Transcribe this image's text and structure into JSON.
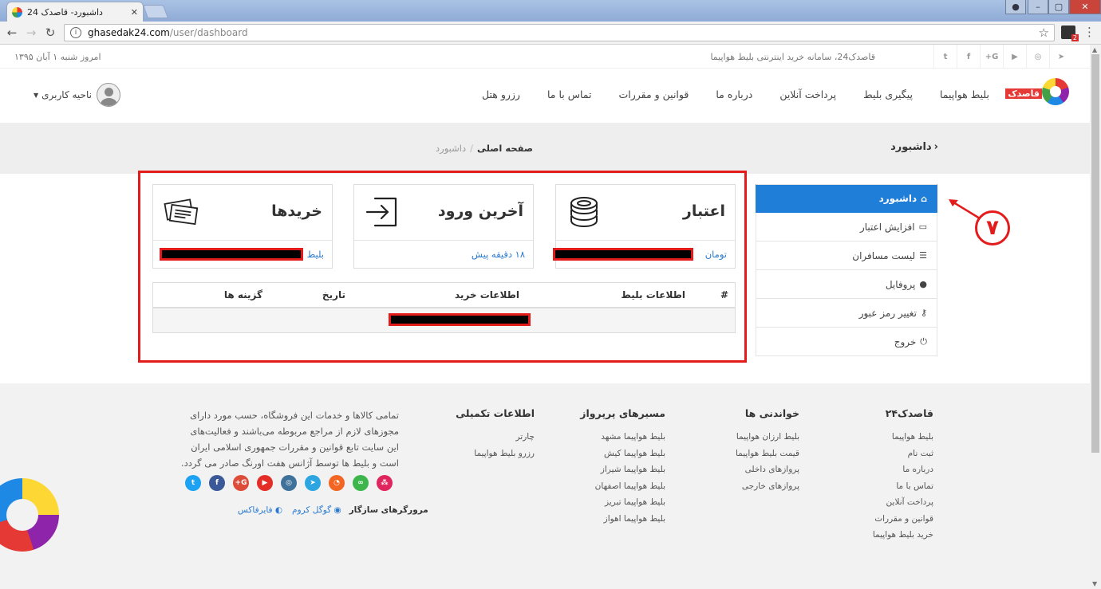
{
  "browser": {
    "tab_title": "داشبورد- قاصدک 24",
    "url_host": "ghasedak24.com",
    "url_path": "/user/dashboard",
    "ext_badge": "2"
  },
  "topbar": {
    "date": "امروز شنبه ۱ آبان ۱۳۹۵",
    "slogan": "قاصدک24، سامانه خرید اینترنتی بلیط هواپیما"
  },
  "nav": {
    "logo_text": "قاصدک",
    "links": [
      "بلیط هواپیما",
      "پیگیری بلیط",
      "پرداخت آنلاین",
      "درباره ما",
      "قوانین و مقررات",
      "تماس با ما",
      "رزرو هتل"
    ],
    "user_label": "ناحیه کاربری"
  },
  "titlebar": {
    "title": "داشبورد",
    "crumb_home": "صفحه اصلی",
    "crumb_current": "داشبورد",
    "crumb_sep": "/"
  },
  "sidebar": {
    "items": [
      {
        "label": "داشبورد",
        "icon": "home-icon"
      },
      {
        "label": "افزایش اعتبار",
        "icon": "battery-icon"
      },
      {
        "label": "لیست مسافران",
        "icon": "list-icon"
      },
      {
        "label": "پروفایل",
        "icon": "user-icon"
      },
      {
        "label": "تغییر رمز عبور",
        "icon": "key-icon"
      },
      {
        "label": "خروج",
        "icon": "power-icon"
      }
    ]
  },
  "annotation": {
    "number": "۷"
  },
  "cards": {
    "credit": {
      "label": "اعتبار",
      "unit": "تومان",
      "icon": "coins-icon"
    },
    "login": {
      "label": "آخرین ورود",
      "value": "۱۸ دقیقه پیش",
      "icon": "sign-in-icon"
    },
    "purchases": {
      "label": "خریدها",
      "unit": "بلیط",
      "icon": "tickets-icon"
    }
  },
  "table": {
    "headers": [
      "#",
      "اطلاعات بلیط",
      "اطلاعات خرید",
      "تاریخ",
      "گزینه ها"
    ]
  },
  "footer": {
    "col1": {
      "title": "قاصدک۲۴",
      "links": [
        "بلیط هواپیما",
        "ثبت نام",
        "درباره ما",
        "تماس با ما",
        "پرداخت آنلاین",
        "قوانین و مقررات",
        "خرید بلیط هواپیما"
      ]
    },
    "col2": {
      "title": "خواندنی ها",
      "links": [
        "بلیط ارزان هواپیما",
        "قیمت بلیط هواپیما",
        "پروازهای داخلی",
        "پروازهای خارجی"
      ]
    },
    "col3": {
      "title": "مسیرهای پرپرواز",
      "links": [
        "بلیط هواپیما مشهد",
        "بلیط هواپیما کیش",
        "بلیط هواپیما شیراز",
        "بلیط هواپیما اصفهان",
        "بلیط هواپیما تبریز",
        "بلیط هواپیما اهواز"
      ]
    },
    "col4": {
      "title": "اطلاعات تکمیلی",
      "links": [
        "چارتر",
        "رزرو بلیط هواپیما"
      ]
    },
    "about": "تمامی کالاها و خدمات این فروشگاه، حسب مورد دارای مجوزهای لازم از مراجع مربوطه می‌باشند و فعالیت‌های این سایت تابع قوانین و مقررات جمهوری اسلامی ایران است و بلیط ها توسط آژانس هفت اورنگ صادر می گردد.",
    "browsers_title": "مرورگرهای سازگار",
    "browser_chrome": "گوگل کروم",
    "browser_firefox": "فایرفاکس",
    "socials": [
      {
        "name": "twitter-icon",
        "color": "#1da1f2",
        "glyph": "t"
      },
      {
        "name": "facebook-icon",
        "color": "#3b5998",
        "glyph": "f"
      },
      {
        "name": "google-plus-icon",
        "color": "#dd4b39",
        "glyph": "G+"
      },
      {
        "name": "youtube-icon",
        "color": "#e52d27",
        "glyph": "▶"
      },
      {
        "name": "instagram-icon",
        "color": "#3f729b",
        "glyph": "◎"
      },
      {
        "name": "telegram-icon",
        "color": "#2ca5e0",
        "glyph": "➤"
      },
      {
        "name": "rss-icon",
        "color": "#f26522",
        "glyph": "◔"
      },
      {
        "name": "aparat-icon",
        "color": "#3cb54a",
        "glyph": "∞"
      },
      {
        "name": "cafebazaar-icon",
        "color": "#e0245e",
        "glyph": "⁂"
      }
    ]
  },
  "colors": {
    "accent": "#1e7ed8",
    "highlight": "#e31b1b",
    "link": "#2a7ad0"
  }
}
